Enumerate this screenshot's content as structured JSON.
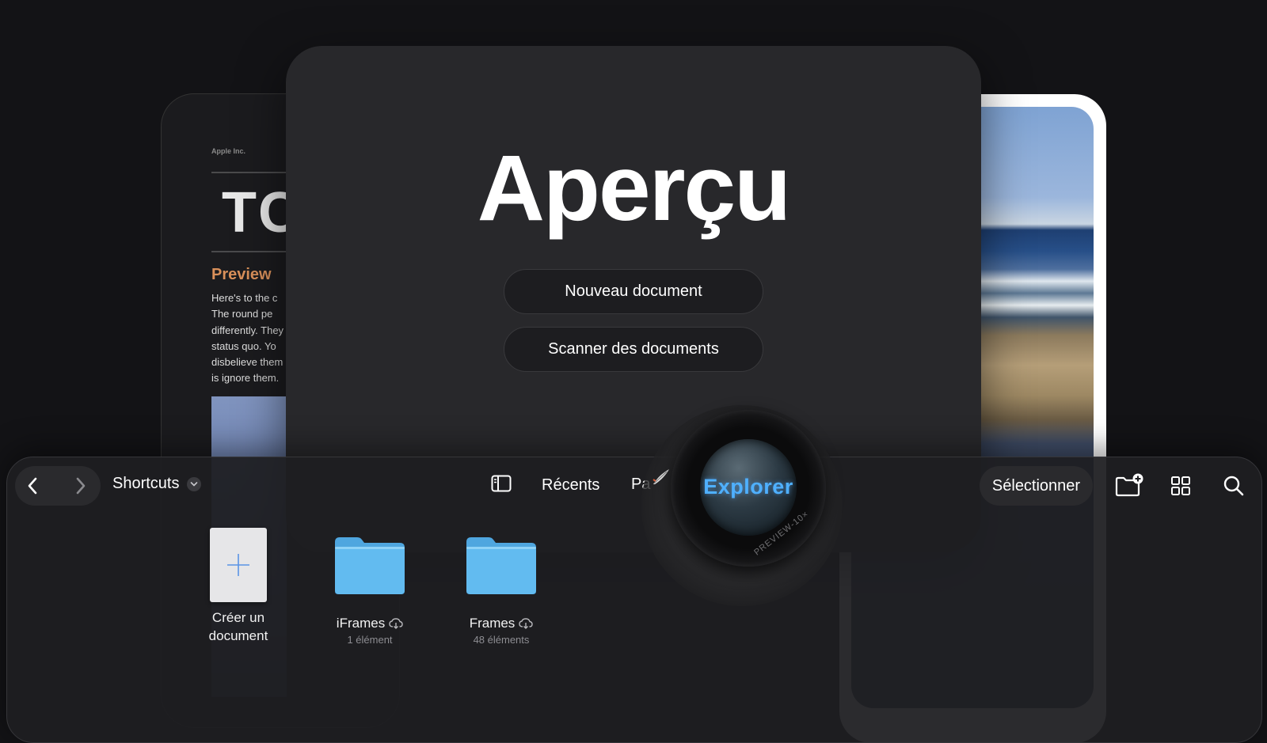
{
  "background_doc": {
    "company": "Apple Inc.",
    "big_text": "TC",
    "heading": "Preview",
    "body_lines": [
      "Here's to the c",
      "The round pe",
      "differently. They",
      "status quo. Yo",
      "disbelieve them",
      "is ignore them."
    ]
  },
  "main": {
    "title": "Aperçu",
    "new_document_label": "Nouveau document",
    "scan_documents_label": "Scanner des documents"
  },
  "toolbar": {
    "location": "Shortcuts",
    "recents_label": "Récents",
    "partial_label": "Pa",
    "select_label": "Sélectionner"
  },
  "lens": {
    "word": "Explorer",
    "engraving": "PREVIEW-10×"
  },
  "files": [
    {
      "name_line1": "Créer un",
      "name_line2": "document"
    },
    {
      "name": "iFrames",
      "count": "1 élément"
    },
    {
      "name": "Frames",
      "count": "48 éléments"
    }
  ],
  "colors": {
    "background": "#131316",
    "card": "#28282b",
    "accent_blue": "#4fb0ff",
    "folder_blue": "#5eb4ea",
    "doc_heading": "#d9905a"
  },
  "icons": [
    "back-chevron-icon",
    "forward-chevron-icon",
    "chevron-down-icon",
    "sidebar-icon",
    "new-folder-icon",
    "grid-view-icon",
    "search-icon",
    "plus-icon",
    "folder-icon",
    "cloud-download-icon"
  ]
}
